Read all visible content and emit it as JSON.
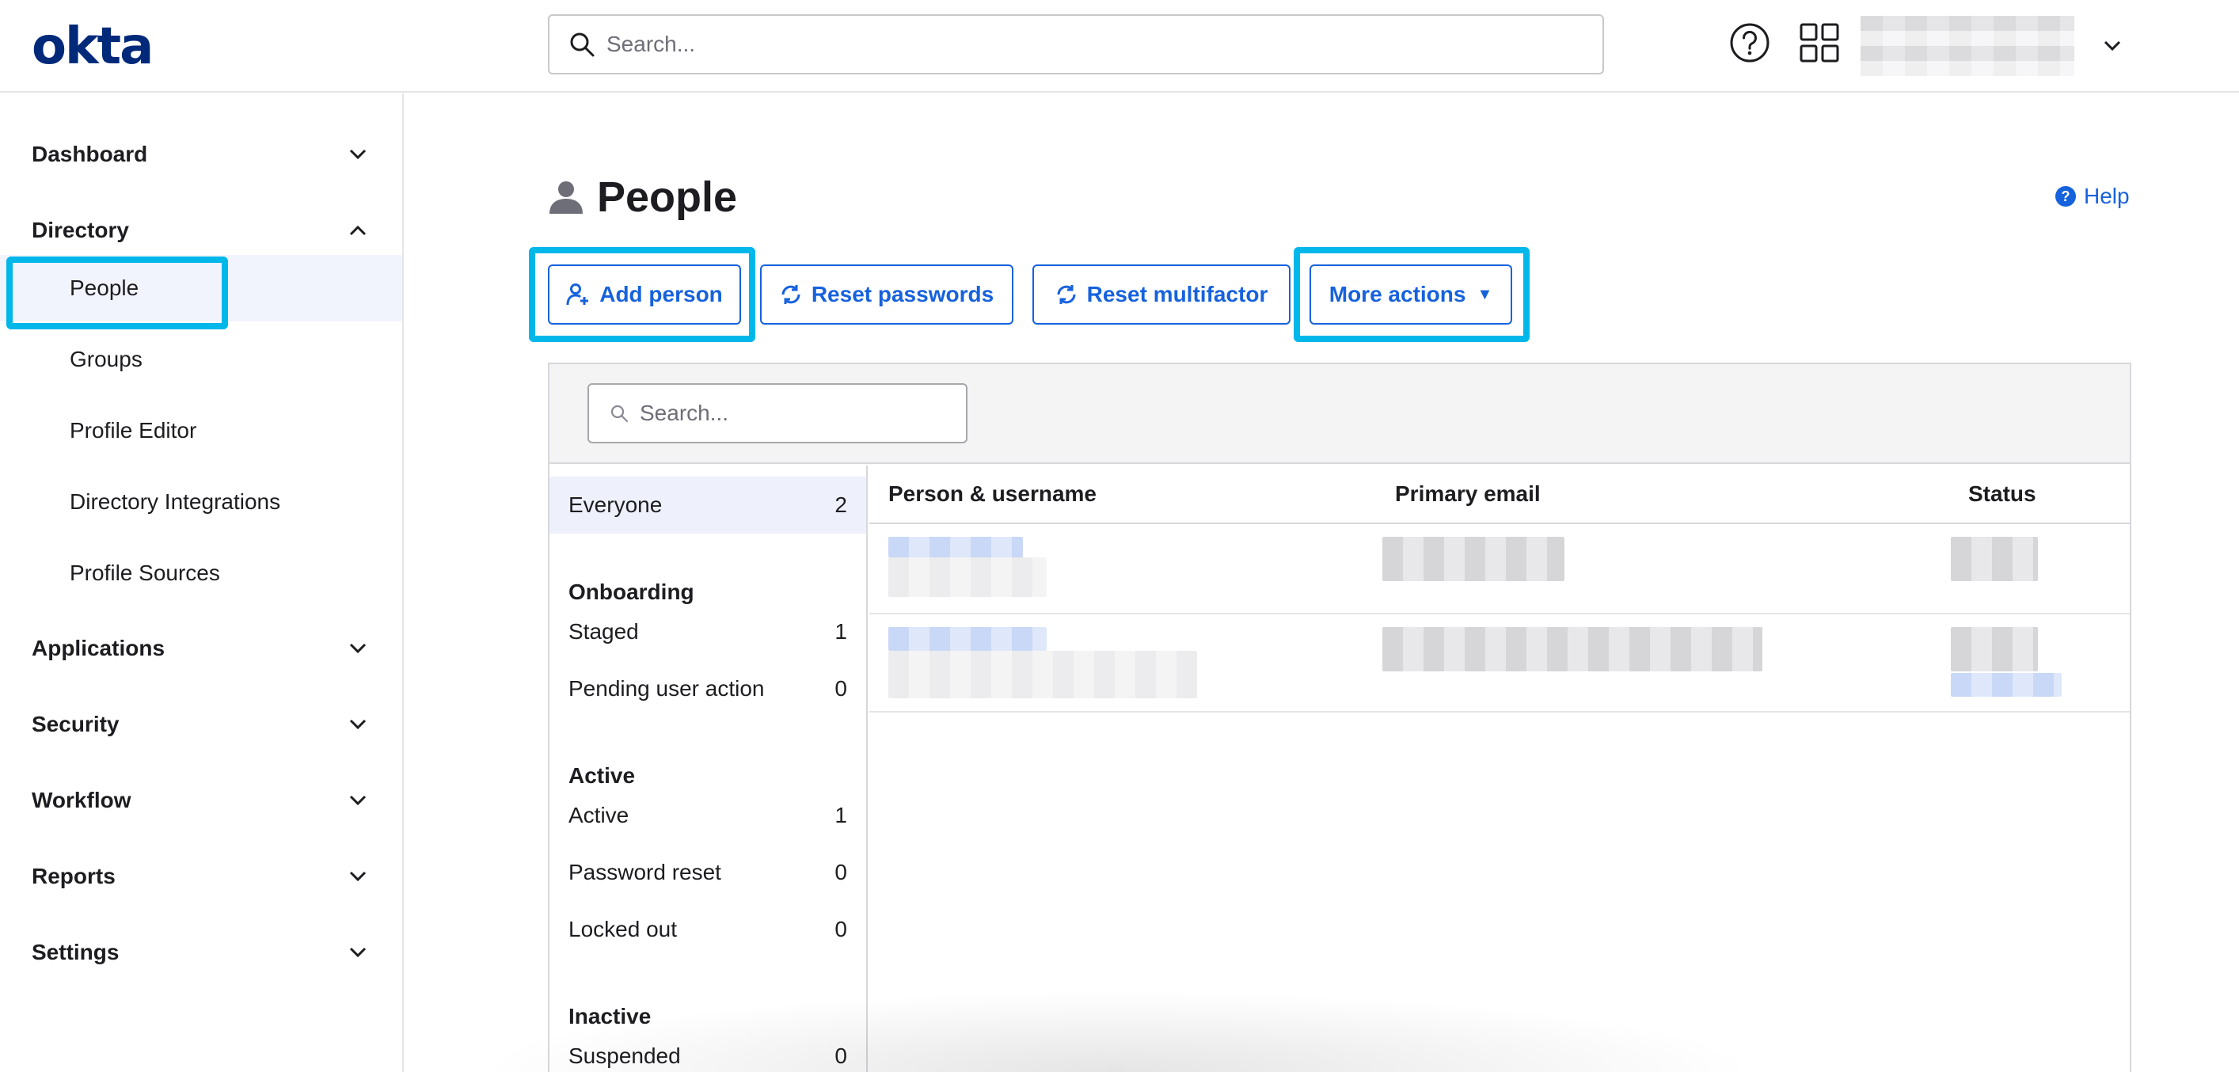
{
  "header": {
    "logo_text": "okta",
    "search_placeholder": "Search..."
  },
  "sidebar": {
    "sections": [
      {
        "label": "Dashboard",
        "expanded": false
      },
      {
        "label": "Directory",
        "expanded": true
      },
      {
        "label": "Applications",
        "expanded": false
      },
      {
        "label": "Security",
        "expanded": false
      },
      {
        "label": "Workflow",
        "expanded": false
      },
      {
        "label": "Reports",
        "expanded": false
      },
      {
        "label": "Settings",
        "expanded": false
      }
    ],
    "directory_items": [
      {
        "label": "People",
        "active": true
      },
      {
        "label": "Groups"
      },
      {
        "label": "Profile Editor"
      },
      {
        "label": "Directory Integrations"
      },
      {
        "label": "Profile Sources"
      }
    ]
  },
  "main": {
    "title": "People",
    "help_label": "Help",
    "buttons": {
      "add_person": "Add person",
      "reset_passwords": "Reset passwords",
      "reset_multifactor": "Reset multifactor",
      "more_actions": "More actions"
    },
    "panel_search_placeholder": "Search...",
    "filters": {
      "everyone": {
        "label": "Everyone",
        "count": "2"
      },
      "onboarding_heading": "Onboarding",
      "staged": {
        "label": "Staged",
        "count": "1"
      },
      "pending": {
        "label": "Pending user action",
        "count": "0"
      },
      "active_heading": "Active",
      "active": {
        "label": "Active",
        "count": "1"
      },
      "password_reset": {
        "label": "Password reset",
        "count": "0"
      },
      "locked_out": {
        "label": "Locked out",
        "count": "0"
      },
      "inactive_heading": "Inactive",
      "suspended": {
        "label": "Suspended",
        "count": "0"
      }
    },
    "table": {
      "columns": [
        "Person & username",
        "Primary email",
        "Status"
      ]
    }
  },
  "colors": {
    "brand": "#00297a",
    "link": "#1662dd",
    "highlight": "#00b7ea"
  }
}
